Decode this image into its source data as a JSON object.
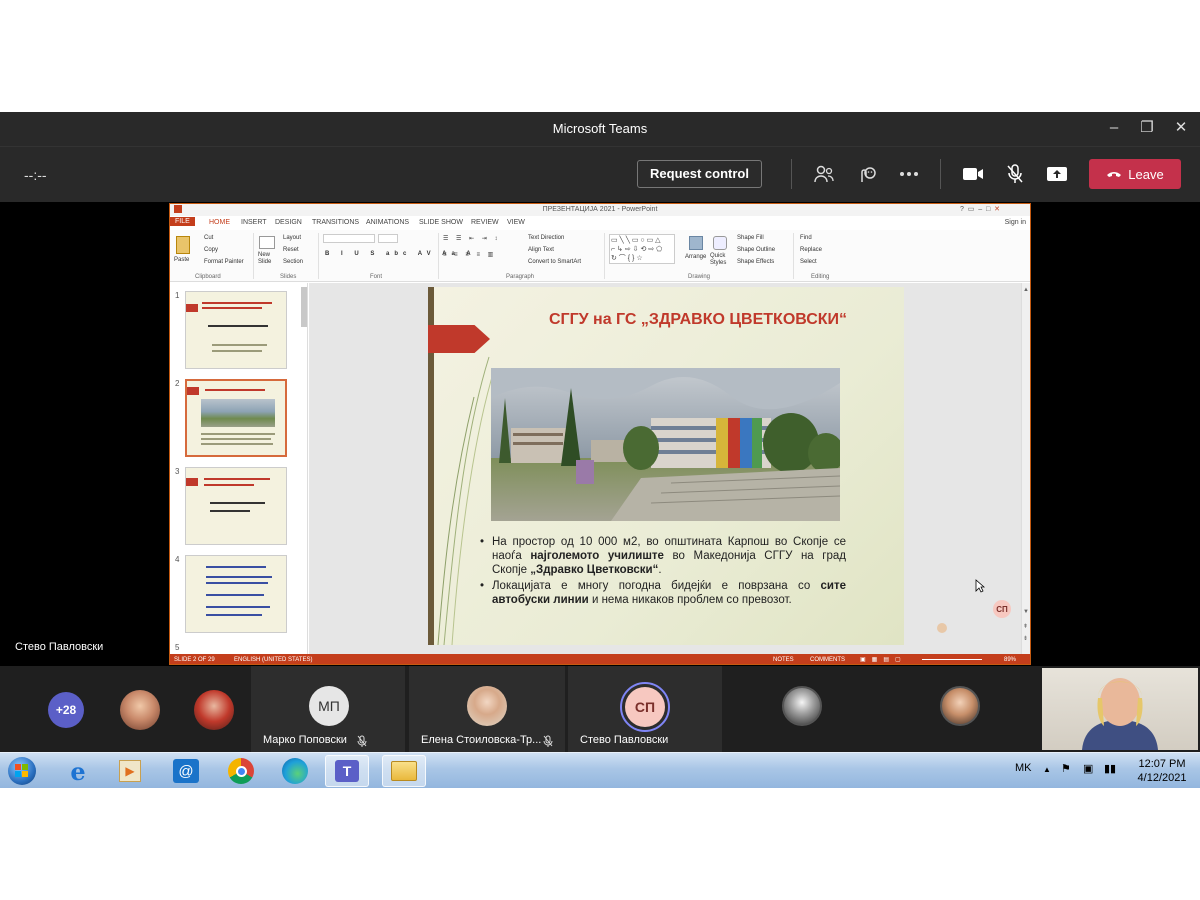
{
  "window": {
    "title": "Microsoft Teams"
  },
  "toolbar": {
    "timer": "--:--",
    "request_control": "Request control",
    "leave": "Leave"
  },
  "presenter": {
    "name": "Стево Павловски",
    "initials_bubble": "СП"
  },
  "powerpoint": {
    "title_bar": "ПРЕЗЕНТАЦИЈА 2021 - PowerPoint",
    "sign_in": "Sign in",
    "tabs": [
      "FILE",
      "HOME",
      "INSERT",
      "DESIGN",
      "TRANSITIONS",
      "ANIMATIONS",
      "SLIDE SHOW",
      "REVIEW",
      "VIEW"
    ],
    "ribbon": {
      "clipboard": {
        "paste": "Paste",
        "cut": "Cut",
        "copy": "Copy",
        "format_painter": "Format Painter",
        "group": "Clipboard"
      },
      "slides": {
        "new_slide": "New Slide",
        "layout": "Layout",
        "reset": "Reset",
        "section": "Section",
        "group": "Slides"
      },
      "font": {
        "group": "Font"
      },
      "paragraph": {
        "text_direction": "Text Direction",
        "align_text": "Align Text",
        "convert": "Convert to SmartArt",
        "group": "Paragraph"
      },
      "drawing": {
        "arrange": "Arrange",
        "quick_styles": "Quick Styles",
        "shape_fill": "Shape Fill",
        "shape_outline": "Shape Outline",
        "shape_effects": "Shape Effects",
        "group": "Drawing"
      },
      "editing": {
        "find": "Find",
        "replace": "Replace",
        "select": "Select",
        "group": "Editing"
      }
    },
    "thumbnails": [
      "1",
      "2",
      "3",
      "4",
      "5"
    ],
    "slide": {
      "title": "СГГУ на ГС „ЗДРАВКО ЦВЕТКОВСКИ“",
      "bullet1_a": "На простор од 10 000 м2, во општината Карпош во Скопје се наоѓа ",
      "bullet1_b": "најголемото училиште",
      "bullet1_c": " во Македонија СГГУ на град Скопје ",
      "bullet1_d": "„Здравко Цветковски“",
      "bullet1_e": ".",
      "bullet2_a": "Локацијата е многу погодна бидејќи е поврзана со ",
      "bullet2_b": "сите автобуски линии",
      "bullet2_c": " и нема никаков проблем со превозот."
    },
    "status": {
      "slide": "SLIDE 2 OF 29",
      "language": "ENGLISH (UNITED STATES)",
      "notes": "NOTES",
      "comments": "COMMENTS",
      "zoom": "89%"
    }
  },
  "participants": {
    "more_count": "+28",
    "tiles": [
      {
        "name": "Марко Поповски",
        "initials": "МП"
      },
      {
        "name": "Елена Стоиловска-Тр...",
        "initials": ""
      },
      {
        "name": "Стево Павловски",
        "initials": "СП"
      }
    ]
  },
  "taskbar": {
    "language": "MK",
    "time": "12:07 PM",
    "date": "4/12/2021"
  },
  "colors": {
    "teams_bg": "#292929",
    "leave": "#c4314b",
    "ppt_accent": "#c43e1c",
    "slide_red": "#c0392b",
    "avatar_purple": "#5b5fc7"
  }
}
